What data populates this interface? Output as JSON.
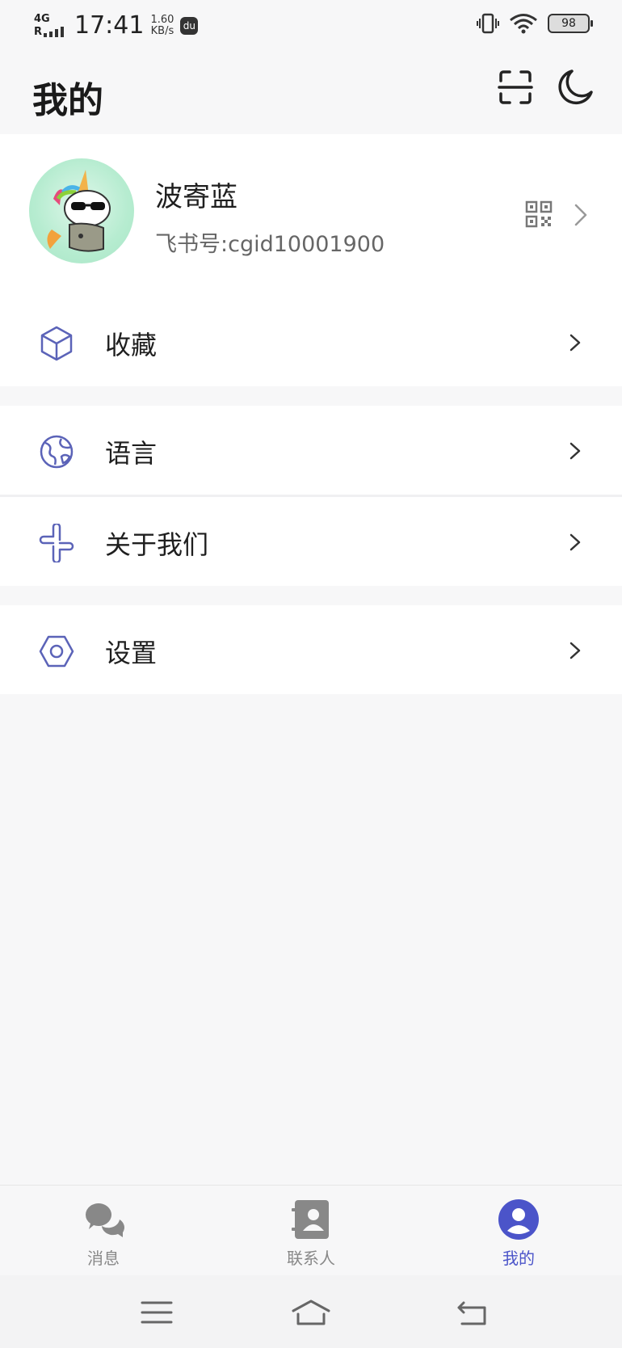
{
  "status_bar": {
    "network": "4G",
    "network_roaming": "R",
    "time": "17:41",
    "speed_value": "1.60",
    "speed_unit": "KB/s",
    "app_icon_text": "du",
    "battery": "98"
  },
  "header": {
    "title": "我的",
    "scan_icon": "scan-icon",
    "theme_icon": "moon-icon"
  },
  "profile": {
    "name": "波寄蓝",
    "id_text": "飞书号:cgid10001900",
    "avatar_icon": "unicorn-avatar"
  },
  "menu": [
    {
      "label": "收藏",
      "icon": "cube-icon"
    },
    {
      "label": "语言",
      "icon": "globe-icon"
    },
    {
      "label": "关于我们",
      "icon": "pinwheel-icon"
    },
    {
      "label": "设置",
      "icon": "hexagon-gear-icon"
    }
  ],
  "tabs": [
    {
      "label": "消息",
      "icon": "chat-bubbles-icon",
      "active": false
    },
    {
      "label": "联系人",
      "icon": "contacts-book-icon",
      "active": false
    },
    {
      "label": "我的",
      "icon": "person-icon",
      "active": true
    }
  ],
  "nav": {
    "menu_icon": "menu-icon",
    "home_icon": "home-icon",
    "back_icon": "back-icon"
  },
  "colors": {
    "accent": "#4b54c9",
    "icon_stroke": "#5b63b8",
    "background": "#f7f7f8",
    "card": "#ffffff"
  }
}
